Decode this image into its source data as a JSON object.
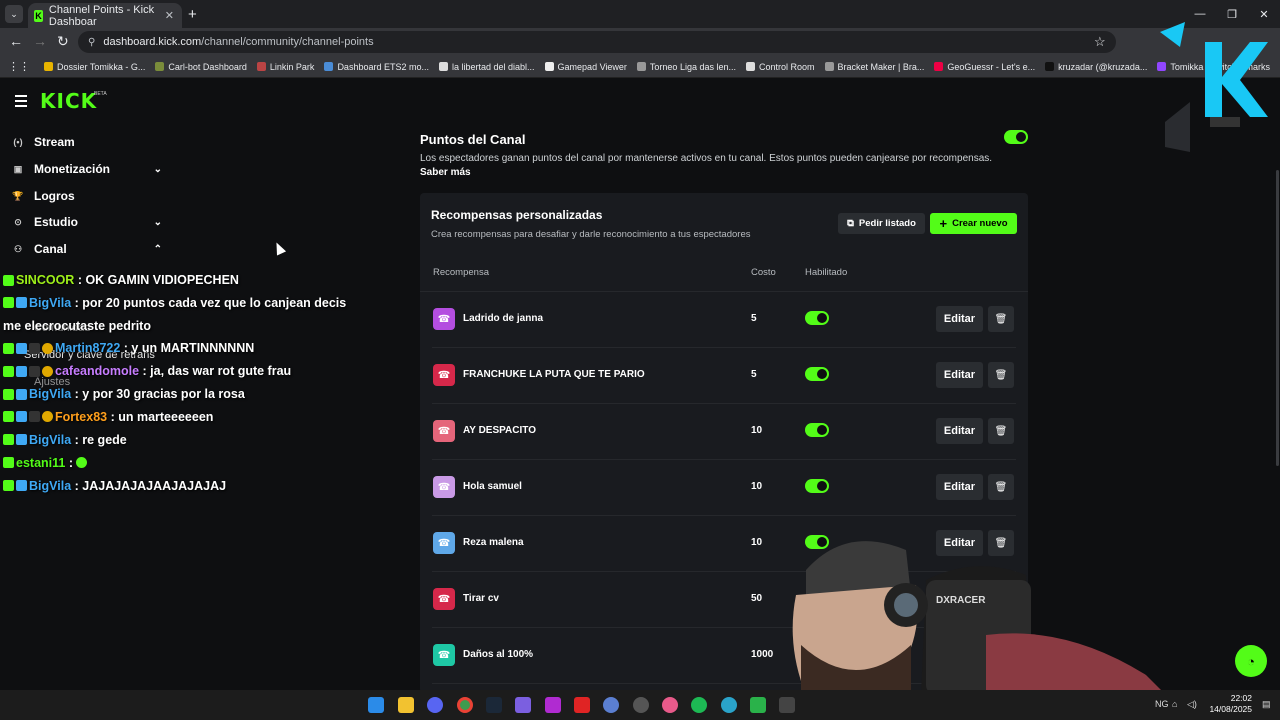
{
  "browser": {
    "tab_title": "Channel Points - Kick Dashboar",
    "url_host": "dashboard.kick.com",
    "url_path": "/channel/community/channel-points",
    "bookmarks": [
      {
        "label": "Dossier Tomikka - G...",
        "color": "#e8b400"
      },
      {
        "label": "Carl-bot Dashboard",
        "color": "#7a8c3a"
      },
      {
        "label": "Linkin Park",
        "color": "#b44"
      },
      {
        "label": "Dashboard ETS2 mo...",
        "color": "#4a8cd6"
      },
      {
        "label": "la libertad del diabl...",
        "color": "#ddd"
      },
      {
        "label": "Gamepad Viewer",
        "color": "#eee"
      },
      {
        "label": "Torneo Liga das len...",
        "color": "#999"
      },
      {
        "label": "Control Room",
        "color": "#ddd"
      },
      {
        "label": "Bracket Maker | Bra...",
        "color": "#999"
      },
      {
        "label": "GeoGuessr - Let's e...",
        "color": "#e04"
      },
      {
        "label": "kruzadar (@kruzada...",
        "color": "#111"
      },
      {
        "label": "Tomikka - Twitch",
        "color": "#9146ff"
      }
    ],
    "bookmarks_overflow": "marks"
  },
  "kick": {
    "logo": "KICK",
    "beta": "BETA"
  },
  "sidebar": {
    "items": [
      {
        "label": "Stream",
        "icon": "stream-icon",
        "glyph": "(•)",
        "chevron": ""
      },
      {
        "label": "Monetización",
        "icon": "monetization-icon",
        "glyph": "▣",
        "chevron": "⌄"
      },
      {
        "label": "Logros",
        "icon": "trophy-icon",
        "glyph": "🏆",
        "chevron": ""
      },
      {
        "label": "Estudio",
        "icon": "studio-icon",
        "glyph": "⊙",
        "chevron": "⌄"
      },
      {
        "label": "Canal",
        "icon": "channel-icon",
        "glyph": "⚇",
        "chevron": "⌃"
      }
    ],
    "ghost_comunidad": "Comunidad",
    "ghost_servidor": "Servidor y clave de retrans",
    "ghost_ajustes": "Ajustes"
  },
  "chat": [
    {
      "badges": [
        "kick"
      ],
      "user": "SINCOOR",
      "color": "#9ef01a",
      "msg": "OK GAMIN VIDIOPECHEN"
    },
    {
      "badges": [
        "kick",
        "blue"
      ],
      "user": "BigVila",
      "color": "#3fa9f5",
      "msg": "por 20 puntos cada vez que lo canjean decis me elecrocutaste pedrito",
      "wrap": true
    },
    {
      "badges": [
        "kick",
        "blue",
        "dark",
        "gold"
      ],
      "user": "Martin8722",
      "color": "#3fa9f5",
      "msg": "y un MARTINNNNNN"
    },
    {
      "badges": [
        "kick",
        "blue",
        "dark",
        "gold"
      ],
      "user": "cafeandomole",
      "color": "#c77dff",
      "msg": "ja, das war rot gute frau"
    },
    {
      "badges": [
        "kick",
        "blue"
      ],
      "user": "BigVila",
      "color": "#3fa9f5",
      "msg": "y por 30 gracias por la rosa"
    },
    {
      "badges": [
        "kick",
        "blue",
        "dark",
        "gold"
      ],
      "user": "Fortex83",
      "color": "#ff9f1c",
      "msg": "un marteeeeeen"
    },
    {
      "badges": [
        "kick",
        "blue"
      ],
      "user": "BigVila",
      "color": "#3fa9f5",
      "msg": "re gede"
    },
    {
      "badges": [
        "kick"
      ],
      "user": "estani11",
      "color": "#53fc18",
      "msg": "",
      "emote": true
    },
    {
      "badges": [
        "kick",
        "blue"
      ],
      "user": "BigVila",
      "color": "#3fa9f5",
      "msg": "JAJAJAJAJAAJAJAJAJ"
    }
  ],
  "main": {
    "title": "Puntos del Canal",
    "desc": "Los espectadores ganan puntos del canal por mantenerse activos en tu canal. Estos puntos pueden canjearse por recompensas.",
    "learn_more": "Saber más",
    "enabled": true
  },
  "rewards": {
    "title": "Recompensas personalizadas",
    "subtitle": "Crea recompensas para desafiar y darle reconocimiento a tus espectadores",
    "request_list": "Pedir listado",
    "create_new": "Crear nuevo",
    "col_reward": "Recompensa",
    "col_cost": "Costo",
    "col_enabled": "Habilitado",
    "edit_label": "Editar",
    "rows": [
      {
        "name": "Ladrido de janna",
        "cost": "5",
        "color": "#b44ee0",
        "enabled": true
      },
      {
        "name": "FRANCHUKE LA PUTA QUE TE PARIO",
        "cost": "5",
        "color": "#d6284a",
        "enabled": true
      },
      {
        "name": "AY DESPACITO",
        "cost": "10",
        "color": "#e5657a",
        "enabled": true
      },
      {
        "name": "Hola samuel",
        "cost": "10",
        "color": "#c99ae6",
        "enabled": true
      },
      {
        "name": "Reza malena",
        "cost": "10",
        "color": "#5fa8e8",
        "enabled": true
      },
      {
        "name": "Tirar cv",
        "cost": "50",
        "color": "#d6284a",
        "enabled": true
      },
      {
        "name": "Daños al 100%",
        "cost": "1000",
        "color": "#1ec8a5",
        "enabled": true
      }
    ]
  },
  "taskbar": {
    "time": "22:02",
    "date": "14/08/2025",
    "lang": "NG"
  },
  "webcam_text": "DXRACER"
}
